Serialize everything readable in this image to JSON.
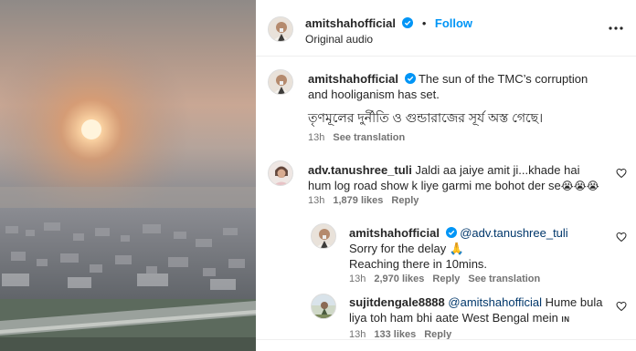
{
  "colors": {
    "accent": "#0095f6",
    "text": "#262626",
    "muted": "#737373",
    "mention": "#00376b"
  },
  "header": {
    "username": "amitshahofficial",
    "separator": "•",
    "follow_label": "Follow",
    "audio_label": "Original audio"
  },
  "caption": {
    "username": "amitshahofficial",
    "text_en": "The sun of the TMC’s corruption and hooliganism has set.",
    "text_bn": "তৃণমূলের দুর্নীতি ও গুন্ডারাজের সূর্য অস্ত গেছে।",
    "time": "13h",
    "see_translation": "See translation"
  },
  "comments": [
    {
      "username": "adv.tanushree_tuli",
      "text": "Jaldi aa jaiye amit ji...khade hai hum log road show k liye garmi me bohot der se",
      "emoji": "😭😭😭",
      "time": "13h",
      "likes": "1,879 likes",
      "reply_label": "Reply"
    },
    {
      "username": "amitshahofficial",
      "mention": "@adv.tanushree_tuli",
      "line1": "Sorry for the delay 🙏",
      "line2": "Reaching there in 10mins.",
      "time": "13h",
      "likes": "2,970 likes",
      "reply_label": "Reply",
      "see_translation": "See translation"
    },
    {
      "username": "sujitdengale8888",
      "mention": "@amitshahofficial",
      "text": "Hume bula liya toh ham bhi aate West Bengal mein",
      "flag": "IN",
      "time": "13h",
      "likes": "133 likes",
      "reply_label": "Reply"
    }
  ],
  "icons": [
    "verified-badge-icon",
    "more-options-icon",
    "heart-icon",
    "sun",
    "city-skyline"
  ]
}
